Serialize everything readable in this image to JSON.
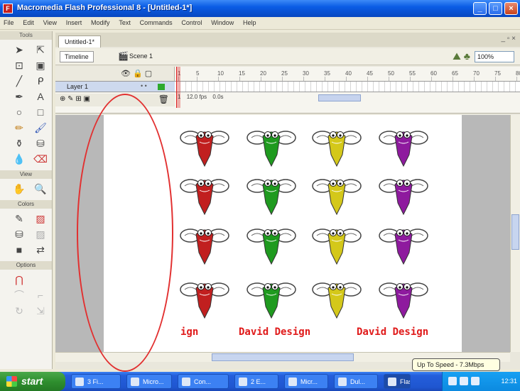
{
  "window": {
    "title": "Macromedia Flash Professional 8 - [Untitled-1*]",
    "app_icon_glyph": "F",
    "controls": {
      "minimize": "_",
      "maximize": "□",
      "close": "×"
    }
  },
  "menu": [
    "File",
    "Edit",
    "View",
    "Insert",
    "Modify",
    "Text",
    "Commands",
    "Control",
    "Window",
    "Help"
  ],
  "tools_panel": {
    "header": "Tools",
    "view_label": "View",
    "colors_label": "Colors",
    "options_label": "Options"
  },
  "document": {
    "tab": "Untitled-1*",
    "doc_controls": "_ ▫ ×",
    "timeline_button": "Timeline",
    "scene": "Scene 1",
    "zoom": "100%"
  },
  "timeline": {
    "layer_header_icons": "👁 🔒 ▢",
    "layer_name": "Layer 1",
    "layer_dots": "• •",
    "frame_numbers": [
      "1",
      "5",
      "10",
      "15",
      "20",
      "25",
      "30",
      "35",
      "40",
      "45",
      "50",
      "55",
      "60",
      "65",
      "70",
      "75",
      "80"
    ],
    "status": [
      "1",
      "12.0 fps",
      "0.0s"
    ],
    "layer_tools": "⊕ ✎ ⊞ ▣",
    "trash": "🗑"
  },
  "stage": {
    "bug_colors": [
      "#c11f1f",
      "#1f9a1f",
      "#d4c81a",
      "#8e1a9e"
    ],
    "design_texts": [
      "ign",
      "David Design",
      "David Design"
    ]
  },
  "taskbar": {
    "start": "start",
    "tasks": [
      "3 Fi...",
      "Micro...",
      "Con...",
      "2 E...",
      "Micr...",
      "Dul...",
      "Flash..."
    ],
    "tooltip": "Up To Speed - 7.3Mbps",
    "clock": "12:31"
  }
}
